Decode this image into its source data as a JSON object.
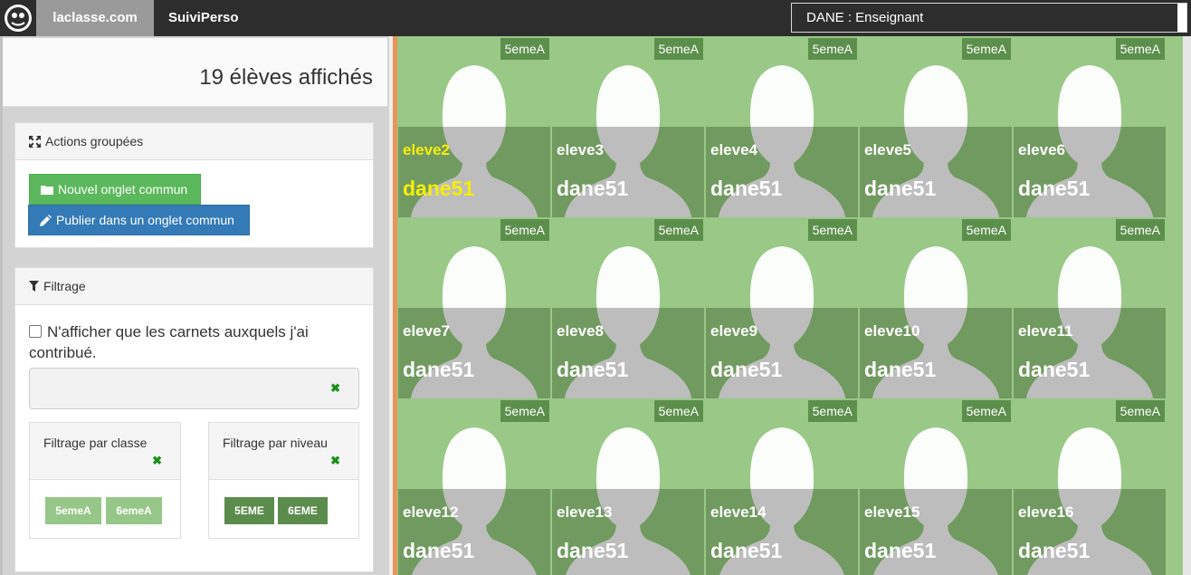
{
  "navbar": {
    "home_label": "laclasse.com",
    "app_label": "SuiviPerso",
    "profile_value": "DANE : Enseignant"
  },
  "sidebar": {
    "count_title": "19 élèves affichés",
    "actions": {
      "heading": "Actions groupées",
      "new_tab_label": "Nouvel onglet commun",
      "publish_label": "Publier dans un onglet commun"
    },
    "filter": {
      "heading": "Filtrage",
      "checkbox_label": "N'afficher que les carnets auxquels j'ai contribué.",
      "search_value": "",
      "by_class_heading": "Filtrage par classe",
      "classes": [
        "5emeA",
        "6emeA"
      ],
      "by_level_heading": "Filtrage par niveau",
      "levels": [
        "5EME",
        "6EME"
      ]
    }
  },
  "students": [
    {
      "class": "5emeA",
      "login": "eleve2",
      "name": "dane51",
      "highlighted": true
    },
    {
      "class": "5emeA",
      "login": "eleve3",
      "name": "dane51"
    },
    {
      "class": "5emeA",
      "login": "eleve4",
      "name": "dane51"
    },
    {
      "class": "5emeA",
      "login": "eleve5",
      "name": "dane51"
    },
    {
      "class": "5emeA",
      "login": "eleve6",
      "name": "dane51"
    },
    {
      "class": "5emeA",
      "login": "eleve7",
      "name": "dane51"
    },
    {
      "class": "5emeA",
      "login": "eleve8",
      "name": "dane51"
    },
    {
      "class": "5emeA",
      "login": "eleve9",
      "name": "dane51"
    },
    {
      "class": "5emeA",
      "login": "eleve10",
      "name": "dane51"
    },
    {
      "class": "5emeA",
      "login": "eleve11",
      "name": "dane51"
    },
    {
      "class": "5emeA",
      "login": "eleve12",
      "name": "dane51"
    },
    {
      "class": "5emeA",
      "login": "eleve13",
      "name": "dane51"
    },
    {
      "class": "5emeA",
      "login": "eleve14",
      "name": "dane51"
    },
    {
      "class": "5emeA",
      "login": "eleve15",
      "name": "dane51"
    },
    {
      "class": "5emeA",
      "login": "eleve16",
      "name": "dane51"
    }
  ],
  "icons": {
    "logo": "laclasse-logo-icon",
    "actions": "expand-icon",
    "filter": "funnel-icon",
    "new_tab": "folder-icon",
    "publish": "pencil-icon",
    "clear": "clear-x-icon",
    "avatar": "person-silhouette-icon"
  },
  "colors": {
    "navbar": "#2d2d2d",
    "tile_bg": "#99c887",
    "tile_band": "#719a60",
    "highlight": "#f7ee0c",
    "primary": "#337ab7",
    "success": "#5cb85c"
  }
}
